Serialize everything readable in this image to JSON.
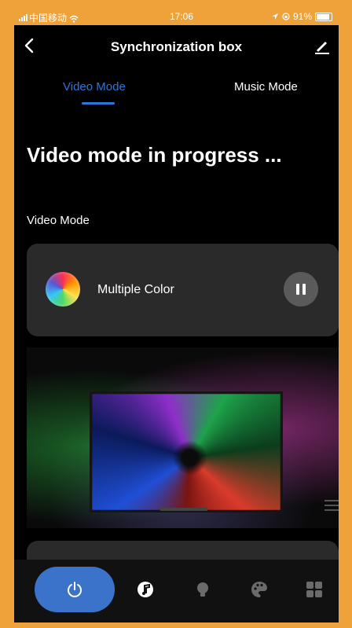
{
  "status": {
    "carrier": "中国移动",
    "time": "17:06",
    "battery": "91%"
  },
  "header": {
    "title": "Synchronization box"
  },
  "tabs": [
    {
      "label": "Video Mode",
      "active": true
    },
    {
      "label": "Music Mode",
      "active": false
    }
  ],
  "main": {
    "heading": "Video mode in progress ...",
    "section_label": "Video Mode",
    "mode_card": {
      "label": "Multiple Color",
      "state": "playing"
    }
  },
  "colors": {
    "accent": "#2b77d9",
    "power": "#3a73c9",
    "card": "#2a2a2a",
    "frame": "#f0a23a"
  },
  "icons": {
    "back": "chevron-left-icon",
    "edit": "pencil-icon",
    "pause": "pause-icon",
    "power": "power-icon",
    "music": "music-note-icon",
    "light": "bulb-icon",
    "palette": "palette-icon",
    "more": "grid-icon"
  }
}
